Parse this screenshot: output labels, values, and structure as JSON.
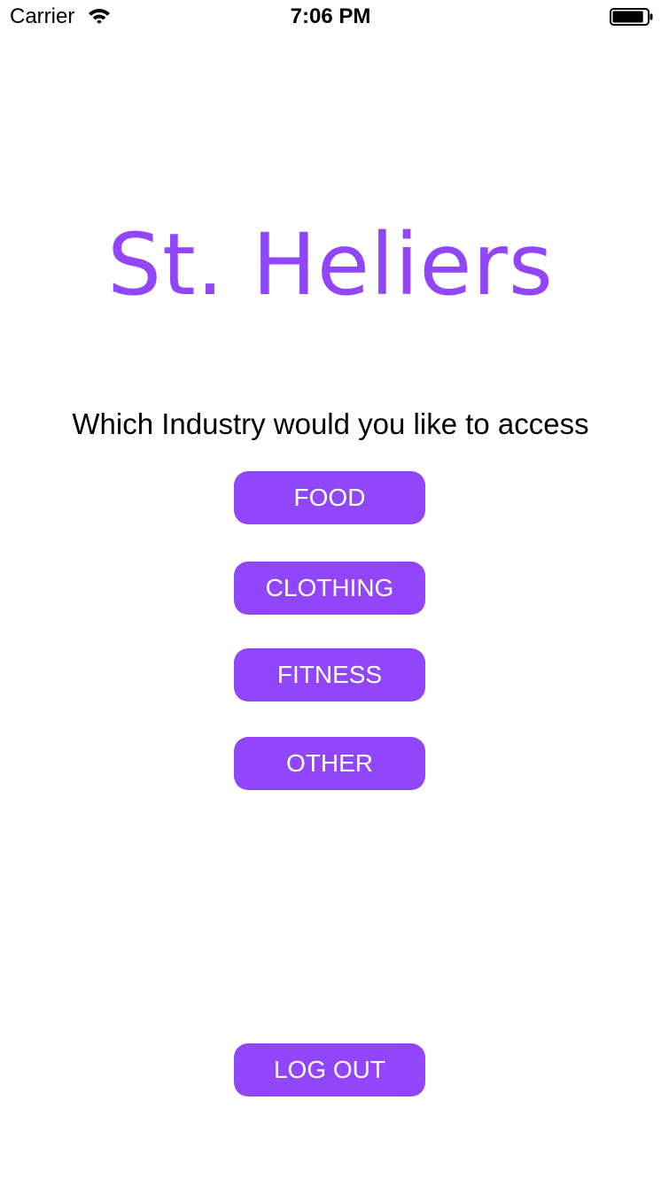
{
  "theme": {
    "accent": "#9146FA",
    "text": "#000000",
    "background": "#FFFFFF"
  },
  "status_bar": {
    "carrier": "Carrier",
    "time": "7:06 PM",
    "wifi_icon": "wifi-icon",
    "battery_icon": "battery-icon",
    "battery_level": 0.9
  },
  "main": {
    "app_title": "St. Heliers",
    "prompt": "Which Industry would you like to access",
    "industry_buttons": [
      {
        "label": "FOOD"
      },
      {
        "label": "CLOTHING"
      },
      {
        "label": "FITNESS"
      },
      {
        "label": "OTHER"
      }
    ],
    "logout_label": "LOG OUT"
  }
}
